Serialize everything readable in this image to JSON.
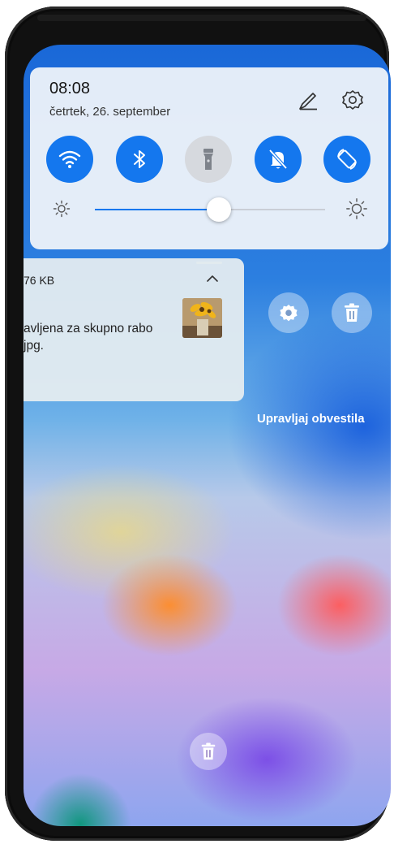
{
  "status": {
    "time": "08:08",
    "date": "četrtek, 26. september"
  },
  "quick_settings": {
    "toggles": [
      {
        "name": "wifi",
        "state": "on",
        "icon": "wifi-icon"
      },
      {
        "name": "bluetooth",
        "state": "on",
        "icon": "bluetooth-icon"
      },
      {
        "name": "flashlight",
        "state": "off",
        "icon": "flashlight-icon"
      },
      {
        "name": "mute-notifications",
        "state": "on",
        "icon": "bell-off-icon"
      },
      {
        "name": "auto-rotate",
        "state": "on",
        "icon": "rotate-icon"
      }
    ],
    "brightness_level": 0.54,
    "accent_color": "#1477ee"
  },
  "notification": {
    "size": "76 KB",
    "body_line1": "avljena za skupno rabo",
    "body_line2": "jpg.",
    "thumbnail_icon": "sunflower-photo"
  },
  "actions": {
    "manage_label": "Upravljaj obvestila",
    "settings_icon": "gear-icon",
    "delete_icon": "trash-icon",
    "clear_all_icon": "trash-icon"
  }
}
